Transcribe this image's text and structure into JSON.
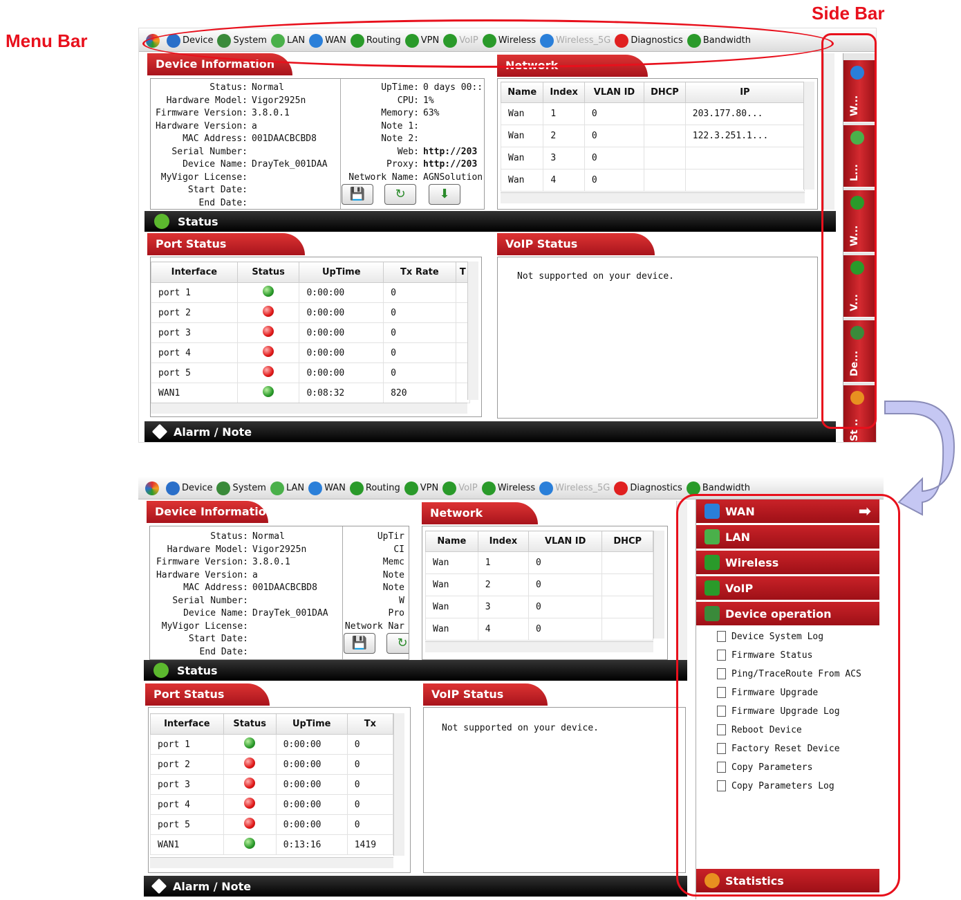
{
  "callouts": {
    "menu_bar": "Menu Bar",
    "side_bar": "Side Bar"
  },
  "menu": {
    "items": [
      {
        "label": "Device",
        "icon": "globe-icon",
        "color": "#2a6fc9",
        "dim": false
      },
      {
        "label": "System",
        "icon": "system-icon",
        "color": "#3a8a3a",
        "dim": false
      },
      {
        "label": "LAN",
        "icon": "lan-icon",
        "color": "#4ab04a",
        "dim": false
      },
      {
        "label": "WAN",
        "icon": "wan-icon",
        "color": "#2a7fd9",
        "dim": false
      },
      {
        "label": "Routing",
        "icon": "routing-icon",
        "color": "#2a9a2a",
        "dim": false
      },
      {
        "label": "VPN",
        "icon": "vpn-icon",
        "color": "#2a9a2a",
        "dim": false
      },
      {
        "label": "VoIP",
        "icon": "voip-icon",
        "color": "#2a9a2a",
        "dim": true
      },
      {
        "label": "Wireless",
        "icon": "wireless-icon",
        "color": "#2a9a2a",
        "dim": false
      },
      {
        "label": "Wireless_5G",
        "icon": "wireless-5g-icon",
        "color": "#2a7fd9",
        "dim": true
      },
      {
        "label": "Diagnostics",
        "icon": "diagnostics-icon",
        "color": "#e02020",
        "dim": false
      },
      {
        "label": "Bandwidth",
        "icon": "bandwidth-icon",
        "color": "#2a9a2a",
        "dim": false
      }
    ]
  },
  "device_info": {
    "title": "Device Information",
    "left": [
      {
        "k": "Status:",
        "v": "Normal"
      },
      {
        "k": "Hardware Model:",
        "v": "Vigor2925n"
      },
      {
        "k": "Firmware Version:",
        "v": "3.8.0.1"
      },
      {
        "k": "Hardware Version:",
        "v": "a"
      },
      {
        "k": "MAC Address:",
        "v": "001DAACBCBD8"
      },
      {
        "k": "Serial Number:",
        "v": ""
      },
      {
        "k": "Device Name:",
        "v": "DrayTek_001DAA"
      },
      {
        "k": "MyVigor License:",
        "v": ""
      },
      {
        "k": "Start Date:",
        "v": ""
      },
      {
        "k": "End Date:",
        "v": ""
      }
    ],
    "right_top": [
      {
        "k": "UpTime:",
        "v": "0 days 00::"
      },
      {
        "k": "CPU:",
        "v": "1%"
      },
      {
        "k": "Memory:",
        "v": "63%"
      },
      {
        "k": "Note 1:",
        "v": ""
      },
      {
        "k": "Note 2:",
        "v": ""
      },
      {
        "k": "Web:",
        "v": "http://203"
      },
      {
        "k": "Proxy:",
        "v": "http://203"
      },
      {
        "k": "Network Name:",
        "v": "AGNSolution"
      }
    ],
    "right_bottom": [
      {
        "k": "UpTir",
        "v": ""
      },
      {
        "k": "CI",
        "v": ""
      },
      {
        "k": "Memc",
        "v": ""
      },
      {
        "k": "Note",
        "v": ""
      },
      {
        "k": "Note",
        "v": ""
      },
      {
        "k": "W",
        "v": ""
      },
      {
        "k": "Pro",
        "v": ""
      },
      {
        "k": "Network Nar",
        "v": ""
      }
    ]
  },
  "network": {
    "title_top": "Network",
    "title_bottom": "Network",
    "headers": [
      "Name",
      "Index",
      "VLAN ID",
      "DHCP",
      "IP"
    ],
    "rows": [
      [
        "Wan",
        "1",
        "0",
        "",
        "203.177.80..."
      ],
      [
        "Wan",
        "2",
        "0",
        "",
        "122.3.251.1..."
      ],
      [
        "Wan",
        "3",
        "0",
        "",
        ""
      ],
      [
        "Wan",
        "4",
        "0",
        "",
        ""
      ]
    ]
  },
  "status_bar": "Status",
  "port_status": {
    "title": "Port Status",
    "headers": [
      "Interface",
      "Status",
      "UpTime",
      "Tx Rate",
      "T"
    ],
    "headers_bottom": [
      "Interface",
      "Status",
      "UpTime",
      "Tx"
    ],
    "rows_top": [
      [
        "port 1",
        "green",
        "0:00:00",
        "0"
      ],
      [
        "port 2",
        "red",
        "0:00:00",
        "0"
      ],
      [
        "port 3",
        "red",
        "0:00:00",
        "0"
      ],
      [
        "port 4",
        "red",
        "0:00:00",
        "0"
      ],
      [
        "port 5",
        "red",
        "0:00:00",
        "0"
      ],
      [
        "WAN1",
        "green",
        "0:08:32",
        "820"
      ]
    ],
    "rows_bottom": [
      [
        "port 1",
        "green",
        "0:00:00",
        "0"
      ],
      [
        "port 2",
        "red",
        "0:00:00",
        "0"
      ],
      [
        "port 3",
        "red",
        "0:00:00",
        "0"
      ],
      [
        "port 4",
        "red",
        "0:00:00",
        "0"
      ],
      [
        "port 5",
        "red",
        "0:00:00",
        "0"
      ],
      [
        "WAN1",
        "green",
        "0:13:16",
        "1419"
      ]
    ]
  },
  "voip_status": {
    "title": "VoIP Status",
    "message": "Not supported on your device."
  },
  "alarm_bar": "Alarm / Note",
  "side_bar_collapsed": [
    {
      "label": "W...",
      "icon": "wan-icon",
      "color": "#2a7fd9"
    },
    {
      "label": "L...",
      "icon": "lan-icon",
      "color": "#4ab04a"
    },
    {
      "label": "W...",
      "icon": "wireless-icon",
      "color": "#2a9a2a"
    },
    {
      "label": "V...",
      "icon": "voip-icon",
      "color": "#2a9a2a"
    },
    {
      "label": "De...",
      "icon": "device-operation-icon",
      "color": "#3a8a3a"
    },
    {
      "label": "St...",
      "icon": "statistics-icon",
      "color": "#e89020"
    }
  ],
  "side_bar_expanded": {
    "sections": [
      {
        "label": "WAN",
        "icon": "wan-icon",
        "color": "#2a7fd9"
      },
      {
        "label": "LAN",
        "icon": "lan-icon",
        "color": "#4ab04a"
      },
      {
        "label": "Wireless",
        "icon": "wireless-icon",
        "color": "#2a9a2a"
      },
      {
        "label": "VoIP",
        "icon": "voip-icon",
        "color": "#2a9a2a"
      },
      {
        "label": "Device operation",
        "icon": "device-operation-icon",
        "color": "#3a8a3a"
      }
    ],
    "items": [
      "Device System Log",
      "Firmware Status",
      "Ping/TraceRoute From ACS",
      "Firmware Upgrade",
      "Firmware Upgrade Log",
      "Reboot Device",
      "Factory Reset Device",
      "Copy Parameters",
      "Copy Parameters Log"
    ],
    "footer": {
      "label": "Statistics",
      "icon": "statistics-icon",
      "color": "#e89020"
    }
  }
}
